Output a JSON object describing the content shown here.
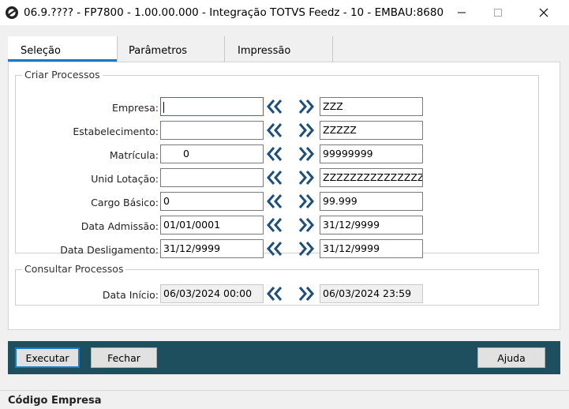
{
  "window": {
    "title": "06.9.???? - FP7800 - 1.00.00.000 - Integração TOTVS Feedz - 10 - EMBAU:8680",
    "minimize": "—",
    "maximize": "☐",
    "close": "✕"
  },
  "tabs": [
    {
      "label": "Seleção"
    },
    {
      "label": "Parâmetros"
    },
    {
      "label": "Impressão"
    }
  ],
  "criar_processos": {
    "title": "Criar Processos",
    "rows": [
      {
        "label": "Empresa:",
        "from": "",
        "to": "ZZZ"
      },
      {
        "label": "Estabelecimento:",
        "from": "",
        "to": "ZZZZZ"
      },
      {
        "label": "Matrícula:",
        "from": "0",
        "to": "99999999"
      },
      {
        "label": "Unid Lotação:",
        "from": "",
        "to": "ZZZZZZZZZZZZZZZZZZ"
      },
      {
        "label": "Cargo Básico:",
        "from": "0",
        "to": "99.999"
      },
      {
        "label": "Data Admissão:",
        "from": "01/01/0001",
        "to": "31/12/9999"
      },
      {
        "label": "Data Desligamento:",
        "from": "31/12/9999",
        "to": "31/12/9999"
      }
    ]
  },
  "consultar_processos": {
    "title": "Consultar Processos",
    "label": "Data Início:",
    "from": "06/03/2024 00:00",
    "to": "06/03/2024 23:59"
  },
  "buttons": {
    "executar": "Executar",
    "fechar": "Fechar",
    "ajuda": "Ajuda"
  },
  "status": {
    "text": "Código Empresa"
  },
  "colors": {
    "accent": "#1a79c9",
    "bottom_bar": "#1d4f5f",
    "arrow": "#1d4f7a"
  }
}
